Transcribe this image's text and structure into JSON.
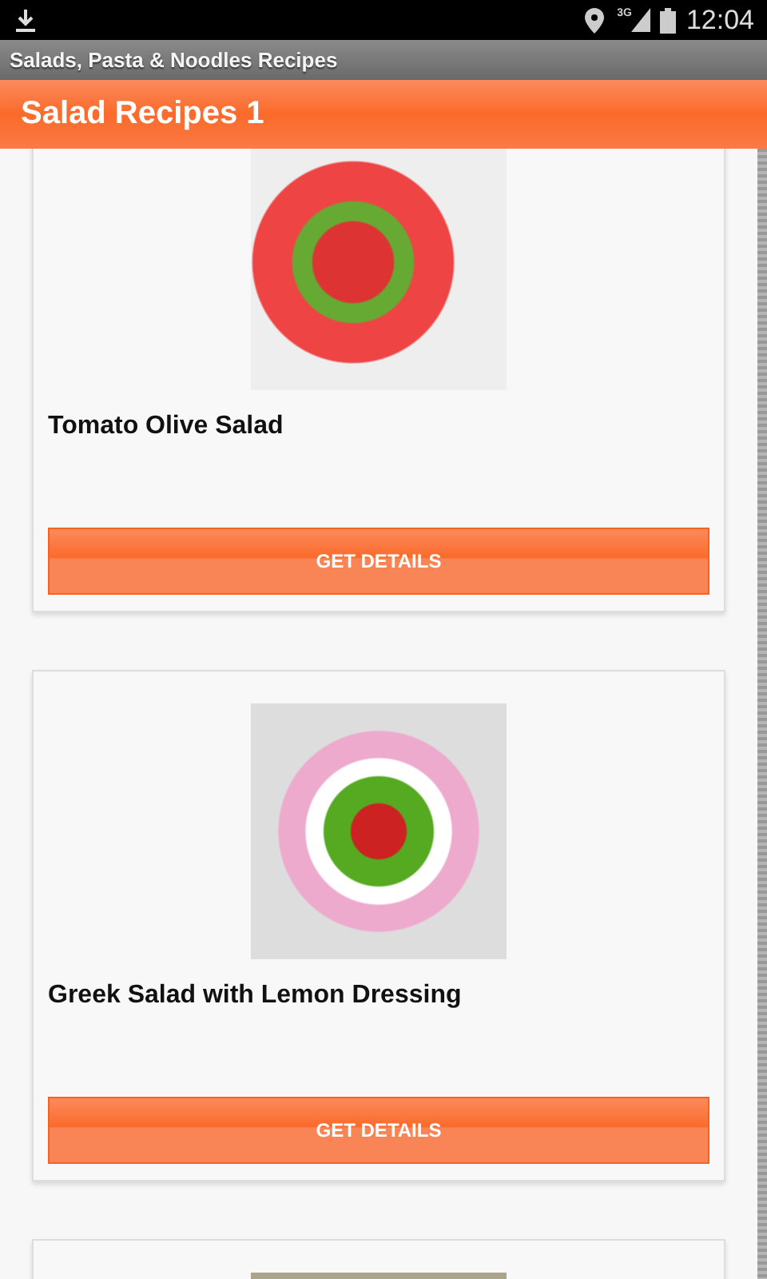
{
  "status_bar": {
    "network_type": "3G",
    "time": "12:04"
  },
  "window": {
    "title": "Salads, Pasta & Noodles Recipes"
  },
  "action_bar": {
    "title": "Salad Recipes 1"
  },
  "recipes": [
    {
      "kind": "full",
      "title": "Tomato Olive Salad",
      "button": "GET DETAILS"
    },
    {
      "kind": "full",
      "title": "Greek Salad with Lemon Dressing",
      "button": "GET DETAILS"
    },
    {
      "kind": "photo_only"
    }
  ]
}
